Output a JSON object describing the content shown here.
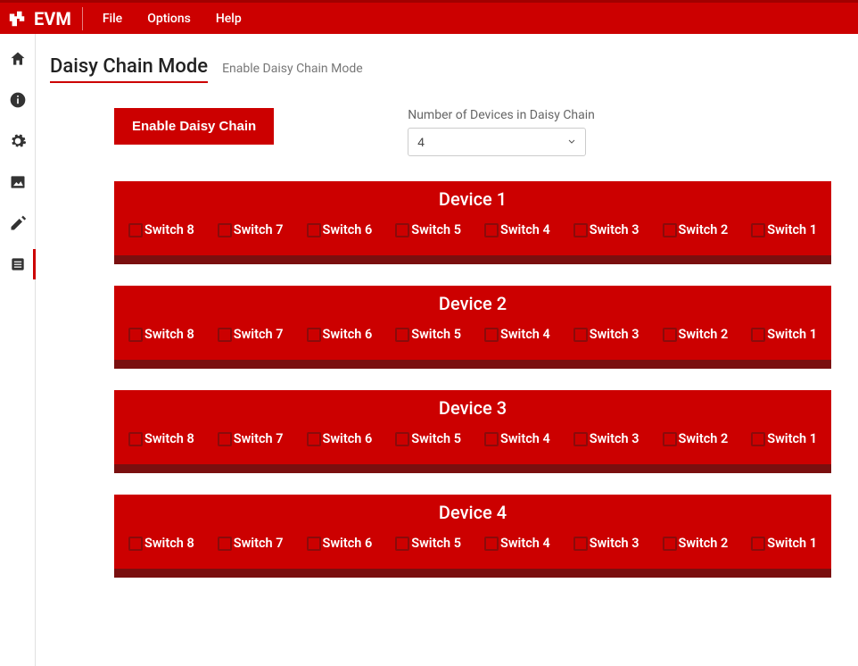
{
  "header": {
    "app_name": "EVM",
    "menu": [
      "File",
      "Options",
      "Help"
    ]
  },
  "page": {
    "title": "Daisy Chain Mode",
    "subtitle": "Enable Daisy Chain Mode"
  },
  "controls": {
    "enable_button_label": "Enable Daisy Chain",
    "num_devices_label": "Number of Devices in Daisy Chain",
    "num_devices_value": "4"
  },
  "devices": [
    {
      "title": "Device 1",
      "switches": [
        "Switch 8",
        "Switch 7",
        "Switch 6",
        "Switch 5",
        "Switch 4",
        "Switch 3",
        "Switch 2",
        "Switch 1"
      ]
    },
    {
      "title": "Device 2",
      "switches": [
        "Switch 8",
        "Switch 7",
        "Switch 6",
        "Switch 5",
        "Switch 4",
        "Switch 3",
        "Switch 2",
        "Switch 1"
      ]
    },
    {
      "title": "Device 3",
      "switches": [
        "Switch 8",
        "Switch 7",
        "Switch 6",
        "Switch 5",
        "Switch 4",
        "Switch 3",
        "Switch 2",
        "Switch 1"
      ]
    },
    {
      "title": "Device 4",
      "switches": [
        "Switch 8",
        "Switch 7",
        "Switch 6",
        "Switch 5",
        "Switch 4",
        "Switch 3",
        "Switch 2",
        "Switch 1"
      ]
    }
  ]
}
